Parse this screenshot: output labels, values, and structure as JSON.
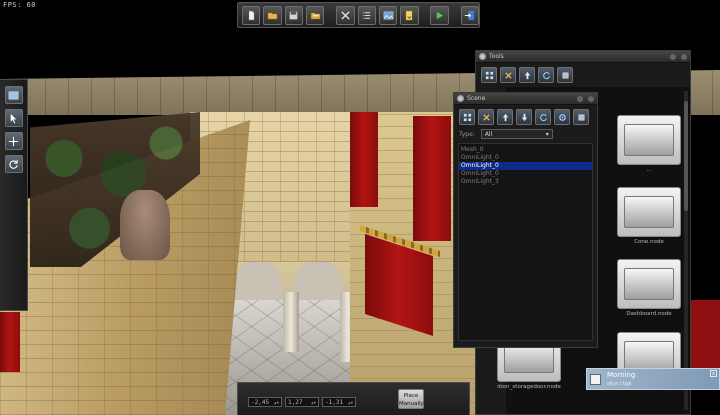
{
  "hud": {
    "fps_text": "FPS: 60"
  },
  "toolbar": {
    "buttons": [
      {
        "id": "new",
        "icon": "new-file-icon"
      },
      {
        "id": "open",
        "icon": "open-folder-icon"
      },
      {
        "id": "save",
        "icon": "save-disk-icon"
      },
      {
        "id": "folder",
        "icon": "folder-icon"
      },
      {
        "id": "tools",
        "icon": "tools-icon"
      },
      {
        "id": "list",
        "icon": "list-icon"
      },
      {
        "id": "image",
        "icon": "image-icon"
      },
      {
        "id": "export",
        "icon": "export-icon"
      },
      {
        "id": "play",
        "icon": "play-icon"
      },
      {
        "id": "exit",
        "icon": "exit-icon"
      }
    ]
  },
  "left_tools": [
    {
      "id": "view",
      "icon": "viewport-icon"
    },
    {
      "id": "select",
      "icon": "cursor-select-icon"
    },
    {
      "id": "move",
      "icon": "move-cross-icon"
    },
    {
      "id": "rotate",
      "icon": "rotate-icon"
    }
  ],
  "files_panel": {
    "title": "Tools",
    "items": [
      {
        "label": "..."
      },
      {
        "label": "Cone.node"
      },
      {
        "label": "Dashboard.node"
      },
      {
        "label": "door_storagedoor.node"
      },
      {
        "label": ""
      }
    ]
  },
  "scene_panel": {
    "title": "Scene",
    "type_label": "Type:",
    "type_value": "All",
    "nodes": [
      {
        "label": "Mesh_0",
        "selected": false
      },
      {
        "label": "OmniLight_0",
        "selected": false
      },
      {
        "label": "OmniLight_0",
        "selected": true
      },
      {
        "label": "OmniLight_0",
        "selected": false
      },
      {
        "label": "OmniLight_3",
        "selected": false
      }
    ]
  },
  "place_bar": {
    "x": "-2,45",
    "y": "1,27",
    "z": "-1,31",
    "button_line1": "Place",
    "button_line2": "Manually"
  },
  "notification": {
    "title": "Morning",
    "subtitle": "skyr.ctga",
    "close": "x"
  }
}
